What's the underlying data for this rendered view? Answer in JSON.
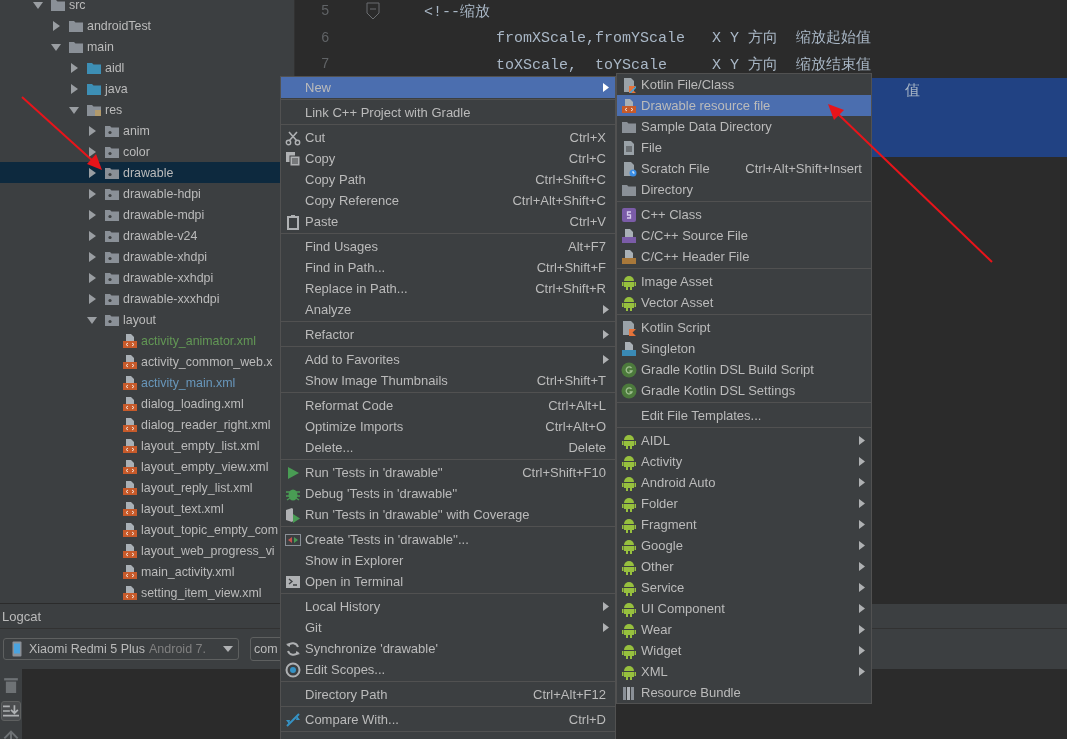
{
  "project_tree": {
    "items": [
      {
        "label": "src",
        "kind": "folder",
        "expanded": true,
        "selected": false,
        "children": [
          {
            "label": "androidTest",
            "kind": "folder",
            "expanded": false,
            "selected": false
          },
          {
            "label": "main",
            "kind": "folder",
            "expanded": true,
            "selected": false,
            "children": [
              {
                "label": "aidl",
                "kind": "source-folder",
                "expanded": false,
                "selected": false
              },
              {
                "label": "java",
                "kind": "source-folder",
                "expanded": false,
                "selected": false
              },
              {
                "label": "res",
                "kind": "res-folder",
                "expanded": true,
                "selected": false,
                "children": [
                  {
                    "label": "anim",
                    "kind": "res-subfolder",
                    "expanded": false,
                    "selected": false
                  },
                  {
                    "label": "color",
                    "kind": "res-subfolder",
                    "expanded": false,
                    "selected": false
                  },
                  {
                    "label": "drawable",
                    "kind": "res-subfolder",
                    "expanded": false,
                    "selected": true
                  },
                  {
                    "label": "drawable-hdpi",
                    "kind": "res-subfolder",
                    "expanded": false,
                    "selected": false
                  },
                  {
                    "label": "drawable-mdpi",
                    "kind": "res-subfolder",
                    "expanded": false,
                    "selected": false
                  },
                  {
                    "label": "drawable-v24",
                    "kind": "res-subfolder",
                    "expanded": false,
                    "selected": false
                  },
                  {
                    "label": "drawable-xhdpi",
                    "kind": "res-subfolder",
                    "expanded": false,
                    "selected": false
                  },
                  {
                    "label": "drawable-xxhdpi",
                    "kind": "res-subfolder",
                    "expanded": false,
                    "selected": false
                  },
                  {
                    "label": "drawable-xxxhdpi",
                    "kind": "res-subfolder",
                    "expanded": false,
                    "selected": false
                  },
                  {
                    "label": "layout",
                    "kind": "res-subfolder",
                    "expanded": true,
                    "selected": false,
                    "children": [
                      {
                        "label": "activity_animator.xml",
                        "kind": "xml-file",
                        "color": "#629755",
                        "selected": false
                      },
                      {
                        "label": "activity_common_web.x",
                        "kind": "xml-file",
                        "color": "#bbbbbb",
                        "selected": false
                      },
                      {
                        "label": "activity_main.xml",
                        "kind": "xml-file",
                        "color": "#6897bb",
                        "selected": false
                      },
                      {
                        "label": "dialog_loading.xml",
                        "kind": "xml-file",
                        "color": "#bbbbbb",
                        "selected": false
                      },
                      {
                        "label": "dialog_reader_right.xml",
                        "kind": "xml-file",
                        "color": "#bbbbbb",
                        "selected": false
                      },
                      {
                        "label": "layout_empty_list.xml",
                        "kind": "xml-file",
                        "color": "#bbbbbb",
                        "selected": false
                      },
                      {
                        "label": "layout_empty_view.xml",
                        "kind": "xml-file",
                        "color": "#bbbbbb",
                        "selected": false
                      },
                      {
                        "label": "layout_reply_list.xml",
                        "kind": "xml-file",
                        "color": "#bbbbbb",
                        "selected": false
                      },
                      {
                        "label": "layout_text.xml",
                        "kind": "xml-file",
                        "color": "#bbbbbb",
                        "selected": false
                      },
                      {
                        "label": "layout_topic_empty_com",
                        "kind": "xml-file",
                        "color": "#bbbbbb",
                        "selected": false
                      },
                      {
                        "label": "layout_web_progress_vi",
                        "kind": "xml-file",
                        "color": "#bbbbbb",
                        "selected": false
                      },
                      {
                        "label": "main_activity.xml",
                        "kind": "xml-file",
                        "color": "#bbbbbb",
                        "selected": false
                      },
                      {
                        "label": "setting_item_view.xml",
                        "kind": "xml-file",
                        "color": "#bbbbbb",
                        "selected": false
                      }
                    ]
                  }
                ]
              }
            ]
          }
        ]
      }
    ]
  },
  "editor": {
    "lines": [
      {
        "number": "5",
        "text": "<!--缩放",
        "fold": true,
        "selected": false
      },
      {
        "number": "6",
        "text": "        fromXScale,fromYScale   X Y 方向  缩放起始值",
        "fold": false,
        "selected": false
      },
      {
        "number": "7",
        "text": "        toXScale,  toYScale     X Y 方向  缩放结束值",
        "fold": false,
        "selected": false
      },
      {
        "text": "值",
        "fold": false,
        "selected": true
      },
      {
        "fold": false,
        "selected": true
      },
      {
        "fold": false,
        "selected": true
      }
    ]
  },
  "logcat": {
    "title": "Logcat",
    "device": {
      "name": "Xiaomi Redmi 5 Plus",
      "detail": "Android 7."
    },
    "process": {
      "value": "com"
    }
  },
  "context_menu": {
    "items": [
      {
        "kind": "plain",
        "label": "New",
        "has_submenu": true,
        "selected": true
      },
      {
        "kind": "separator"
      },
      {
        "kind": "plain",
        "label": "Link C++ Project with Gradle",
        "has_submenu": false,
        "selected": false
      },
      {
        "kind": "separator"
      },
      {
        "kind": "scissors",
        "label": "Cut",
        "shortcut": "Ctrl+X",
        "has_submenu": false,
        "selected": false
      },
      {
        "kind": "copy",
        "label": "Copy",
        "shortcut": "Ctrl+C",
        "has_submenu": false,
        "selected": false
      },
      {
        "kind": "plain",
        "label": "Copy Path",
        "shortcut": "Ctrl+Shift+C",
        "has_submenu": false,
        "selected": false
      },
      {
        "kind": "plain",
        "label": "Copy Reference",
        "shortcut": "Ctrl+Alt+Shift+C",
        "has_submenu": false,
        "selected": false
      },
      {
        "kind": "paste",
        "label": "Paste",
        "shortcut": "Ctrl+V",
        "has_submenu": false,
        "selected": false
      },
      {
        "kind": "separator"
      },
      {
        "kind": "plain",
        "label": "Find Usages",
        "shortcut": "Alt+F7",
        "has_submenu": false,
        "selected": false
      },
      {
        "kind": "plain",
        "label": "Find in Path...",
        "shortcut": "Ctrl+Shift+F",
        "has_submenu": false,
        "selected": false
      },
      {
        "kind": "plain",
        "label": "Replace in Path...",
        "shortcut": "Ctrl+Shift+R",
        "has_submenu": false,
        "selected": false
      },
      {
        "kind": "plain",
        "label": "Analyze",
        "has_submenu": true,
        "selected": false
      },
      {
        "kind": "separator"
      },
      {
        "kind": "plain",
        "label": "Refactor",
        "has_submenu": true,
        "selected": false
      },
      {
        "kind": "separator"
      },
      {
        "kind": "plain",
        "label": "Add to Favorites",
        "has_submenu": true,
        "selected": false
      },
      {
        "kind": "plain",
        "label": "Show Image Thumbnails",
        "shortcut": "Ctrl+Shift+T",
        "has_submenu": false,
        "selected": false
      },
      {
        "kind": "separator"
      },
      {
        "kind": "plain",
        "label": "Reformat Code",
        "shortcut": "Ctrl+Alt+L",
        "has_submenu": false,
        "selected": false
      },
      {
        "kind": "plain",
        "label": "Optimize Imports",
        "shortcut": "Ctrl+Alt+O",
        "has_submenu": false,
        "selected": false
      },
      {
        "kind": "plain",
        "label": "Delete...",
        "shortcut": "Delete",
        "has_submenu": false,
        "selected": false
      },
      {
        "kind": "separator"
      },
      {
        "kind": "run",
        "label": "Run 'Tests in 'drawable''",
        "shortcut": "Ctrl+Shift+F10",
        "has_submenu": false,
        "selected": false
      },
      {
        "kind": "debug",
        "label": "Debug 'Tests in 'drawable''",
        "has_submenu": false,
        "selected": false
      },
      {
        "kind": "coverage",
        "label": "Run 'Tests in 'drawable'' with Coverage",
        "has_submenu": false,
        "selected": false
      },
      {
        "kind": "separator"
      },
      {
        "kind": "create-test",
        "label": "Create 'Tests in 'drawable''...",
        "has_submenu": false,
        "selected": false
      },
      {
        "kind": "plain",
        "label": "Show in Explorer",
        "has_submenu": false,
        "selected": false
      },
      {
        "kind": "terminal",
        "label": "Open in Terminal",
        "has_submenu": false,
        "selected": false
      },
      {
        "kind": "separator"
      },
      {
        "kind": "plain",
        "label": "Local History",
        "has_submenu": true,
        "selected": false
      },
      {
        "kind": "plain",
        "label": "Git",
        "has_submenu": true,
        "selected": false
      },
      {
        "kind": "sync",
        "label": "Synchronize 'drawable'",
        "has_submenu": false,
        "selected": false
      },
      {
        "kind": "scope",
        "label": "Edit Scopes...",
        "has_submenu": false,
        "selected": false
      },
      {
        "kind": "separator"
      },
      {
        "kind": "plain",
        "label": "Directory Path",
        "shortcut": "Ctrl+Alt+F12",
        "has_submenu": false,
        "selected": false
      },
      {
        "kind": "separator"
      },
      {
        "kind": "compare",
        "label": "Compare With...",
        "shortcut": "Ctrl+D",
        "has_submenu": false,
        "selected": false
      },
      {
        "kind": "separator"
      }
    ]
  },
  "submenu": {
    "items": [
      {
        "kind": "kotlin",
        "label": "Kotlin File/Class",
        "has_submenu": false,
        "selected": false
      },
      {
        "kind": "xml-file",
        "label": "Drawable resource file",
        "has_submenu": false,
        "selected": true
      },
      {
        "kind": "folder",
        "label": "Sample Data Directory",
        "has_submenu": false,
        "selected": false
      },
      {
        "kind": "file",
        "label": "File",
        "has_submenu": false,
        "selected": false
      },
      {
        "kind": "scratch",
        "label": "Scratch File",
        "shortcut": "Ctrl+Alt+Shift+Insert",
        "has_submenu": false,
        "selected": false
      },
      {
        "kind": "folder",
        "label": "Directory",
        "has_submenu": false,
        "selected": false
      },
      {
        "kind": "separator"
      },
      {
        "kind": "cpp-class",
        "label": "C++ Class",
        "has_submenu": false,
        "selected": false
      },
      {
        "kind": "cpp-source",
        "label": "C/C++ Source File",
        "has_submenu": false,
        "selected": false
      },
      {
        "kind": "cpp-header",
        "label": "C/C++ Header File",
        "has_submenu": false,
        "selected": false
      },
      {
        "kind": "separator"
      },
      {
        "kind": "android",
        "label": "Image Asset",
        "has_submenu": false,
        "selected": false
      },
      {
        "kind": "android",
        "label": "Vector Asset",
        "has_submenu": false,
        "selected": false
      },
      {
        "kind": "separator"
      },
      {
        "kind": "kotlin-script",
        "label": "Kotlin Script",
        "has_submenu": false,
        "selected": false
      },
      {
        "kind": "singleton",
        "label": "Singleton",
        "has_submenu": false,
        "selected": false
      },
      {
        "kind": "gradle",
        "label": "Gradle Kotlin DSL Build Script",
        "has_submenu": false,
        "selected": false
      },
      {
        "kind": "gradle",
        "label": "Gradle Kotlin DSL Settings",
        "has_submenu": false,
        "selected": false
      },
      {
        "kind": "separator"
      },
      {
        "kind": "plain",
        "label": "Edit File Templates...",
        "has_submenu": false,
        "selected": false
      },
      {
        "kind": "separator"
      },
      {
        "kind": "android",
        "label": "AIDL",
        "has_submenu": true,
        "selected": false
      },
      {
        "kind": "android",
        "label": "Activity",
        "has_submenu": true,
        "selected": false
      },
      {
        "kind": "android",
        "label": "Android Auto",
        "has_submenu": true,
        "selected": false
      },
      {
        "kind": "android",
        "label": "Folder",
        "has_submenu": true,
        "selected": false
      },
      {
        "kind": "android",
        "label": "Fragment",
        "has_submenu": true,
        "selected": false
      },
      {
        "kind": "android",
        "label": "Google",
        "has_submenu": true,
        "selected": false
      },
      {
        "kind": "android",
        "label": "Other",
        "has_submenu": true,
        "selected": false
      },
      {
        "kind": "android",
        "label": "Service",
        "has_submenu": true,
        "selected": false
      },
      {
        "kind": "android",
        "label": "UI Component",
        "has_submenu": true,
        "selected": false
      },
      {
        "kind": "android",
        "label": "Wear",
        "has_submenu": true,
        "selected": false
      },
      {
        "kind": "android",
        "label": "Widget",
        "has_submenu": true,
        "selected": false
      },
      {
        "kind": "android",
        "label": "XML",
        "has_submenu": true,
        "selected": false
      },
      {
        "kind": "resource-bundle",
        "label": "Resource Bundle",
        "has_submenu": false,
        "selected": false
      }
    ]
  }
}
